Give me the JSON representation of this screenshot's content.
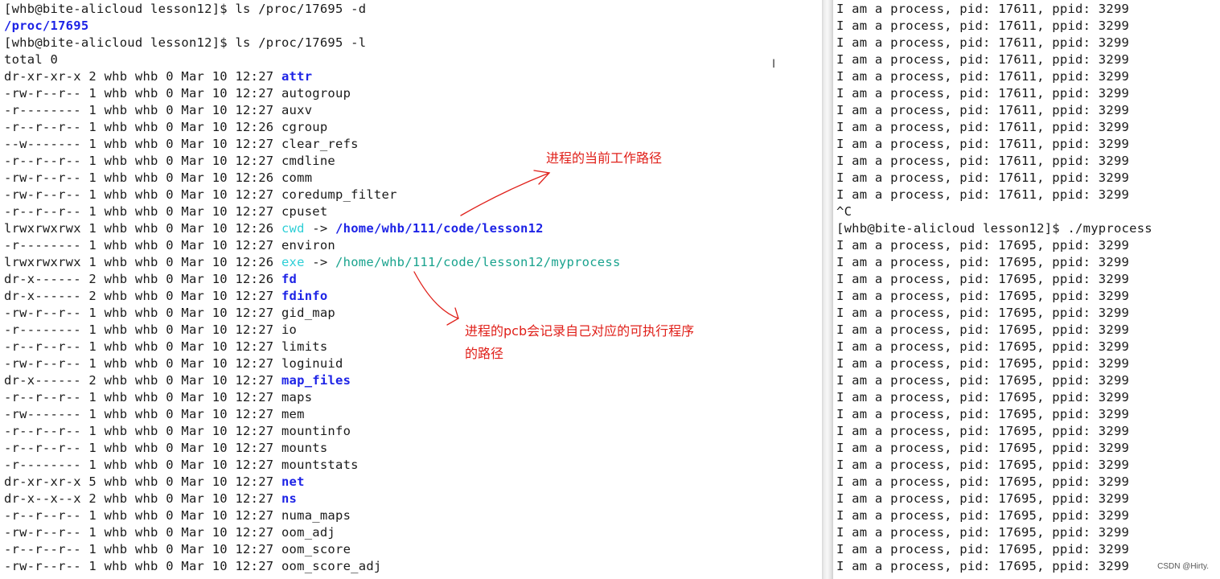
{
  "left_terminal": {
    "lines": [
      [
        {
          "text": "[whb@bite-alicloud lesson12]$ ls /proc/17695 -d"
        }
      ],
      [
        {
          "text": "/proc/17695",
          "style": "blue"
        }
      ],
      [
        {
          "text": "[whb@bite-alicloud lesson12]$ ls /proc/17695 -l"
        }
      ],
      [
        {
          "text": "total 0"
        }
      ],
      [
        {
          "text": "dr-xr-xr-x 2 whb whb 0 Mar 10 12:27 "
        },
        {
          "text": "attr",
          "style": "blue"
        }
      ],
      [
        {
          "text": "-rw-r--r-- 1 whb whb 0 Mar 10 12:27 autogroup"
        }
      ],
      [
        {
          "text": "-r-------- 1 whb whb 0 Mar 10 12:27 auxv"
        }
      ],
      [
        {
          "text": "-r--r--r-- 1 whb whb 0 Mar 10 12:26 cgroup"
        }
      ],
      [
        {
          "text": "--w------- 1 whb whb 0 Mar 10 12:27 clear_refs"
        }
      ],
      [
        {
          "text": "-r--r--r-- 1 whb whb 0 Mar 10 12:27 cmdline"
        }
      ],
      [
        {
          "text": "-rw-r--r-- 1 whb whb 0 Mar 10 12:26 comm"
        }
      ],
      [
        {
          "text": "-rw-r--r-- 1 whb whb 0 Mar 10 12:27 coredump_filter"
        }
      ],
      [
        {
          "text": "-r--r--r-- 1 whb whb 0 Mar 10 12:27 cpuset"
        }
      ],
      [
        {
          "text": "lrwxrwxrwx 1 whb whb 0 Mar 10 12:26 "
        },
        {
          "text": "cwd",
          "style": "cyan"
        },
        {
          "text": " -> "
        },
        {
          "text": "/home/whb/111/code/lesson12",
          "style": "blue"
        }
      ],
      [
        {
          "text": "-r-------- 1 whb whb 0 Mar 10 12:27 environ"
        }
      ],
      [
        {
          "text": "lrwxrwxrwx 1 whb whb 0 Mar 10 12:26 "
        },
        {
          "text": "exe",
          "style": "cyan"
        },
        {
          "text": " -> "
        },
        {
          "text": "/home/whb/111/code/lesson12/myprocess",
          "style": "teal"
        }
      ],
      [
        {
          "text": "dr-x------ 2 whb whb 0 Mar 10 12:26 "
        },
        {
          "text": "fd",
          "style": "blue"
        }
      ],
      [
        {
          "text": "dr-x------ 2 whb whb 0 Mar 10 12:27 "
        },
        {
          "text": "fdinfo",
          "style": "blue"
        }
      ],
      [
        {
          "text": "-rw-r--r-- 1 whb whb 0 Mar 10 12:27 gid_map"
        }
      ],
      [
        {
          "text": "-r-------- 1 whb whb 0 Mar 10 12:27 io"
        }
      ],
      [
        {
          "text": "-r--r--r-- 1 whb whb 0 Mar 10 12:27 limits"
        }
      ],
      [
        {
          "text": "-rw-r--r-- 1 whb whb 0 Mar 10 12:27 loginuid"
        }
      ],
      [
        {
          "text": "dr-x------ 2 whb whb 0 Mar 10 12:27 "
        },
        {
          "text": "map_files",
          "style": "blue"
        }
      ],
      [
        {
          "text": "-r--r--r-- 1 whb whb 0 Mar 10 12:27 maps"
        }
      ],
      [
        {
          "text": "-rw------- 1 whb whb 0 Mar 10 12:27 mem"
        }
      ],
      [
        {
          "text": "-r--r--r-- 1 whb whb 0 Mar 10 12:27 mountinfo"
        }
      ],
      [
        {
          "text": "-r--r--r-- 1 whb whb 0 Mar 10 12:27 mounts"
        }
      ],
      [
        {
          "text": "-r-------- 1 whb whb 0 Mar 10 12:27 mountstats"
        }
      ],
      [
        {
          "text": "dr-xr-xr-x 5 whb whb 0 Mar 10 12:27 "
        },
        {
          "text": "net",
          "style": "blue"
        }
      ],
      [
        {
          "text": "dr-x--x--x 2 whb whb 0 Mar 10 12:27 "
        },
        {
          "text": "ns",
          "style": "blue"
        }
      ],
      [
        {
          "text": "-r--r--r-- 1 whb whb 0 Mar 10 12:27 numa_maps"
        }
      ],
      [
        {
          "text": "-rw-r--r-- 1 whb whb 0 Mar 10 12:27 oom_adj"
        }
      ],
      [
        {
          "text": "-r--r--r-- 1 whb whb 0 Mar 10 12:27 oom_score"
        }
      ],
      [
        {
          "text": "-rw-r--r-- 1 whb whb 0 Mar 10 12:27 oom_score_adj"
        }
      ]
    ]
  },
  "right_terminal": {
    "lines": [
      "I am a process, pid: 17611, ppid: 3299",
      "I am a process, pid: 17611, ppid: 3299",
      "I am a process, pid: 17611, ppid: 3299",
      "I am a process, pid: 17611, ppid: 3299",
      "I am a process, pid: 17611, ppid: 3299",
      "I am a process, pid: 17611, ppid: 3299",
      "I am a process, pid: 17611, ppid: 3299",
      "I am a process, pid: 17611, ppid: 3299",
      "I am a process, pid: 17611, ppid: 3299",
      "I am a process, pid: 17611, ppid: 3299",
      "I am a process, pid: 17611, ppid: 3299",
      "I am a process, pid: 17611, ppid: 3299",
      "^C",
      "[whb@bite-alicloud lesson12]$ ./myprocess",
      "I am a process, pid: 17695, ppid: 3299",
      "I am a process, pid: 17695, ppid: 3299",
      "I am a process, pid: 17695, ppid: 3299",
      "I am a process, pid: 17695, ppid: 3299",
      "I am a process, pid: 17695, ppid: 3299",
      "I am a process, pid: 17695, ppid: 3299",
      "I am a process, pid: 17695, ppid: 3299",
      "I am a process, pid: 17695, ppid: 3299",
      "I am a process, pid: 17695, ppid: 3299",
      "I am a process, pid: 17695, ppid: 3299",
      "I am a process, pid: 17695, ppid: 3299",
      "I am a process, pid: 17695, ppid: 3299",
      "I am a process, pid: 17695, ppid: 3299",
      "I am a process, pid: 17695, ppid: 3299",
      "I am a process, pid: 17695, ppid: 3299",
      "I am a process, pid: 17695, ppid: 3299",
      "I am a process, pid: 17695, ppid: 3299",
      "I am a process, pid: 17695, ppid: 3299",
      "I am a process, pid: 17695, ppid: 3299",
      "I am a process, pid: 17695, ppid: 3299"
    ]
  },
  "annotations": {
    "cwd_note": "进程的当前工作路径",
    "exe_note": "进程的pcb会记录自己对应的可执行程序的路径"
  },
  "watermark": "CSDN @Hirty.",
  "colors": {
    "directory_blue": "#1d23e6",
    "symlink_cyan": "#2ecfd6",
    "executable_teal": "#1aa38e",
    "annotation_red": "#e0201a"
  }
}
